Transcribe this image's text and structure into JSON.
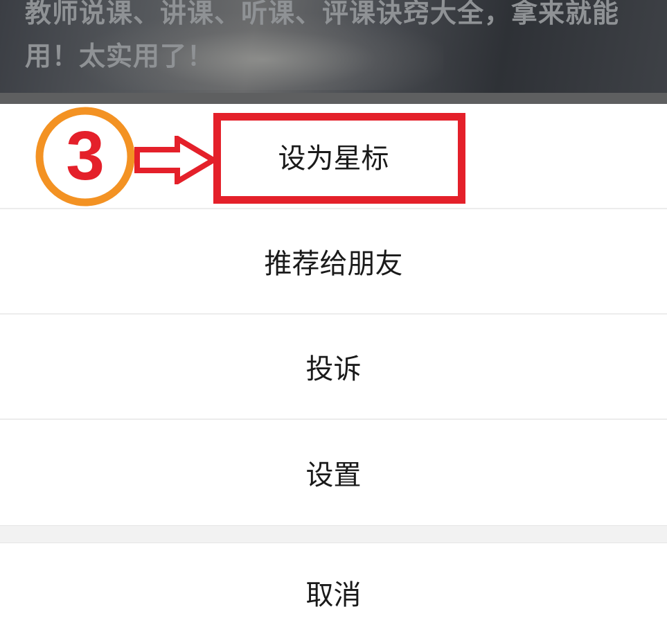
{
  "article": {
    "title": "教师说课、讲课、听课、评课诀窍大全，拿来就能用！太实用了！"
  },
  "menu": {
    "items": [
      {
        "label": "设为星标"
      },
      {
        "label": "推荐给朋友"
      },
      {
        "label": "投诉"
      },
      {
        "label": "设置"
      }
    ],
    "cancel_label": "取消"
  },
  "annotation": {
    "step_number": "3",
    "badge_ring_color": "#f39223",
    "badge_text_color": "#e4202a",
    "highlight_color": "#e4202a",
    "icons": [
      "step-number-badge",
      "right-arrow-icon"
    ]
  }
}
